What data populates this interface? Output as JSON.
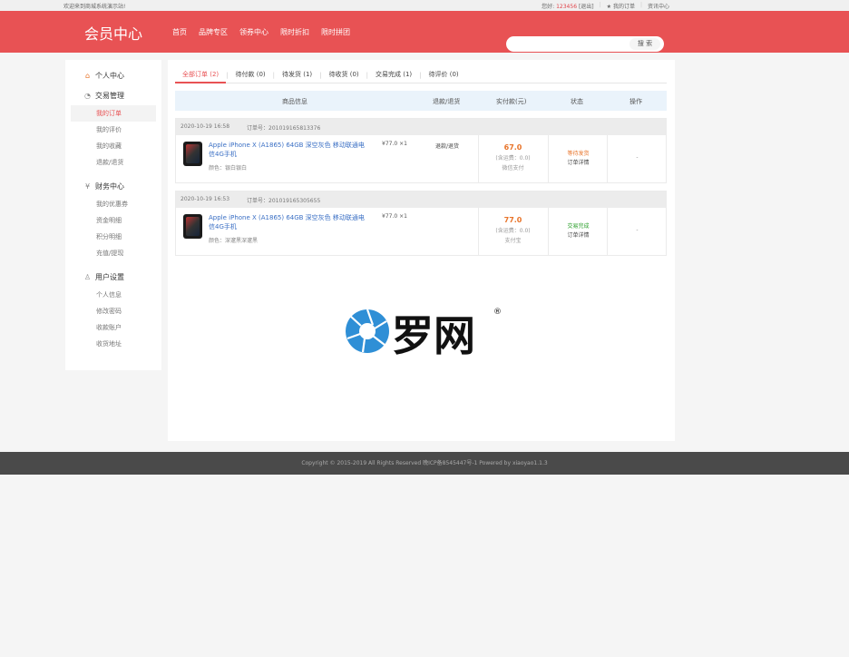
{
  "topbar": {
    "welcome": "欢迎来到商城系统演示站!",
    "greeting": "您好:",
    "username": "123456",
    "logout": "[退出]",
    "my_orders": "★ 我的订单",
    "news_center": "资讯中心"
  },
  "header": {
    "logo": "会员中心",
    "nav": [
      "首页",
      "品牌专区",
      "领券中心",
      "限时折扣",
      "限时拼团"
    ],
    "search_placeholder": "",
    "search_button": "搜 索"
  },
  "sidebar": {
    "groups": [
      {
        "title": "个人中心",
        "icon": "home-icon",
        "items": []
      },
      {
        "title": "交易管理",
        "icon": "clock-icon",
        "items": [
          "我的订单",
          "我的评价",
          "我的收藏",
          "退款/退货"
        ]
      },
      {
        "title": "财务中心",
        "icon": "wallet-icon",
        "items": [
          "我的优惠券",
          "资金明细",
          "积分明细",
          "充值/提现"
        ]
      },
      {
        "title": "用户设置",
        "icon": "user-icon",
        "items": [
          "个人信息",
          "修改密码",
          "收款账户",
          "收货地址"
        ]
      }
    ],
    "active_item": "我的订单"
  },
  "tabs": [
    {
      "label": "全部订单 (2)",
      "active": true
    },
    {
      "label": "待付款 (0)",
      "active": false
    },
    {
      "label": "待发货 (1)",
      "active": false
    },
    {
      "label": "待收货 (0)",
      "active": false
    },
    {
      "label": "交易完成 (1)",
      "active": false
    },
    {
      "label": "待评价 (0)",
      "active": false
    }
  ],
  "table_headers": [
    "商品信息",
    "退款/退货",
    "实付款(元)",
    "状态",
    "操作"
  ],
  "orders": [
    {
      "date": "2020-10-19 16:58",
      "order_no": "订单号：201019165813376",
      "product": "Apple iPhone X (A1865) 64GB 深空灰色 移动联通电信4G手机",
      "color": "颜色：银白银白",
      "price": "¥77.0 ×1",
      "refund": "退款/退货",
      "amount": "67.0",
      "shipping": "(含运费：0.0)",
      "method": "微信支付",
      "status": "等待发货",
      "status_color": "#e8742a",
      "detail": "订单详情",
      "op": "-"
    },
    {
      "date": "2020-10-19 16:53",
      "order_no": "订单号：201019165305655",
      "product": "Apple iPhone X (A1865) 64GB 深空灰色 移动联通电信4G手机",
      "color": "颜色：深邃黑深邃黑",
      "price": "¥77.0 ×1",
      "refund": "",
      "amount": "77.0",
      "shipping": "(含运费：0.0)",
      "method": "支付宝",
      "status": "交易完成",
      "status_color": "#2ca02c",
      "detail": "订单详情",
      "op": "-"
    }
  ],
  "watermark": {
    "text": "罗网",
    "mark": "®"
  },
  "footer": "Copyright © 2015-2019 All Rights Reserved 晚ICP备8545447号-1   Powered by xiaoyao1.1.3",
  "colors": {
    "brand": "#e85254",
    "accent": "#e8742a",
    "success": "#2ca02c",
    "link": "#3a6fc4"
  }
}
